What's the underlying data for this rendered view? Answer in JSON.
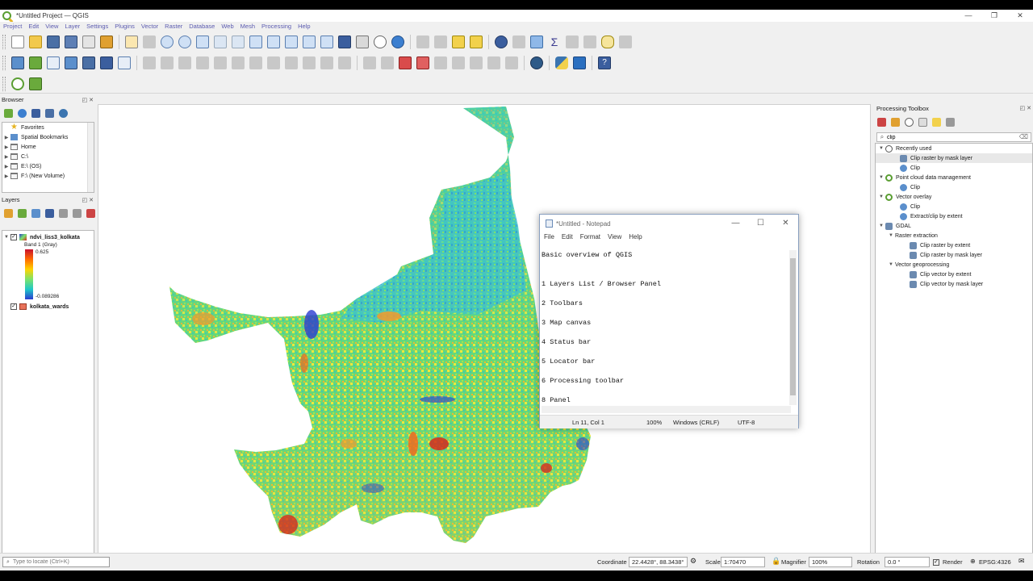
{
  "titlebar": {
    "title": "*Untitled Project — QGIS",
    "minimize": "—",
    "restore": "❐",
    "close": "✕"
  },
  "menubar": [
    "Project",
    "Edit",
    "View",
    "Layer",
    "Settings",
    "Plugins",
    "Vector",
    "Raster",
    "Database",
    "Web",
    "Mesh",
    "Processing",
    "Help"
  ],
  "browser": {
    "title": "Browser",
    "panel_buttons": "◰ ✕",
    "items": [
      {
        "label": "Favorites",
        "icon": "star-icon"
      },
      {
        "label": "Spatial Bookmarks",
        "icon": "bookmark-icon"
      },
      {
        "label": "Home",
        "icon": "folder-icon"
      },
      {
        "label": "C:\\",
        "icon": "drive-icon"
      },
      {
        "label": "E:\\ (OS)",
        "icon": "drive-icon"
      },
      {
        "label": "F:\\ (New Volume)",
        "icon": "drive-icon"
      }
    ]
  },
  "layers": {
    "title": "Layers",
    "panel_buttons": "◰ ✕",
    "raster_layer": {
      "name": "ndvi_liss3_kolkata",
      "band": "Band 1 (Gray)",
      "max": "0.625",
      "min": "-0.089286"
    },
    "vector_layer": {
      "name": "kolkata_wards",
      "color": "#e8725a"
    }
  },
  "processing": {
    "title": "Processing Toolbox",
    "panel_buttons": "◰ ✕",
    "search_value": "clip",
    "groups": [
      {
        "label": "Recently used",
        "icon": "clock-icon",
        "items": [
          {
            "label": "Clip raster by mask layer",
            "icon": "gdal-icon",
            "selected": true
          },
          {
            "label": "Clip",
            "icon": "gear-icon"
          }
        ]
      },
      {
        "label": "Point cloud data management",
        "icon": "qgis-icon",
        "items": [
          {
            "label": "Clip",
            "icon": "gear-icon"
          }
        ]
      },
      {
        "label": "Vector overlay",
        "icon": "qgis-icon",
        "items": [
          {
            "label": "Clip",
            "icon": "gear-icon"
          },
          {
            "label": "Extract/clip by extent",
            "icon": "gear-icon"
          }
        ]
      }
    ],
    "gdal": {
      "label": "GDAL",
      "subgroups": [
        {
          "label": "Raster extraction",
          "items": [
            "Clip raster by extent",
            "Clip raster by mask layer"
          ]
        },
        {
          "label": "Vector geoprocessing",
          "items": [
            "Clip vector by extent",
            "Clip vector by mask layer"
          ]
        }
      ]
    }
  },
  "notepad": {
    "title": "*Untitled - Notepad",
    "menu": [
      "File",
      "Edit",
      "Format",
      "View",
      "Help"
    ],
    "lines": [
      "Basic overview of QGIS",
      "",
      "",
      "1 Layers List / Browser Panel",
      "",
      "2 Toolbars",
      "",
      "3 Map canvas",
      "",
      "4 Status bar",
      "",
      "5 Locator bar",
      "",
      "6 Processing toolbar",
      "",
      "8 Panel"
    ],
    "status": {
      "position": "Ln 11, Col 1",
      "zoom": "100%",
      "line_ending": "Windows (CRLF)",
      "encoding": "UTF-8"
    }
  },
  "statusbar": {
    "locator_placeholder": "Type to locate (Ctrl+K)",
    "coordinate_label": "Coordinate",
    "coordinate_value": "22.4428°, 88.3438°",
    "scale_label": "Scale",
    "scale_value": "1:70470",
    "magnifier_label": "Magnifier",
    "magnifier_value": "100%",
    "rotation_label": "Rotation",
    "rotation_value": "0.0 °",
    "render_label": "Render",
    "crs": "EPSG:4326"
  },
  "colors": {
    "ndvi_low": "#2b3bd1",
    "ndvi_mid": "#7be36b",
    "ndvi_high": "#d42a1f",
    "accent": "#5a9e32"
  }
}
